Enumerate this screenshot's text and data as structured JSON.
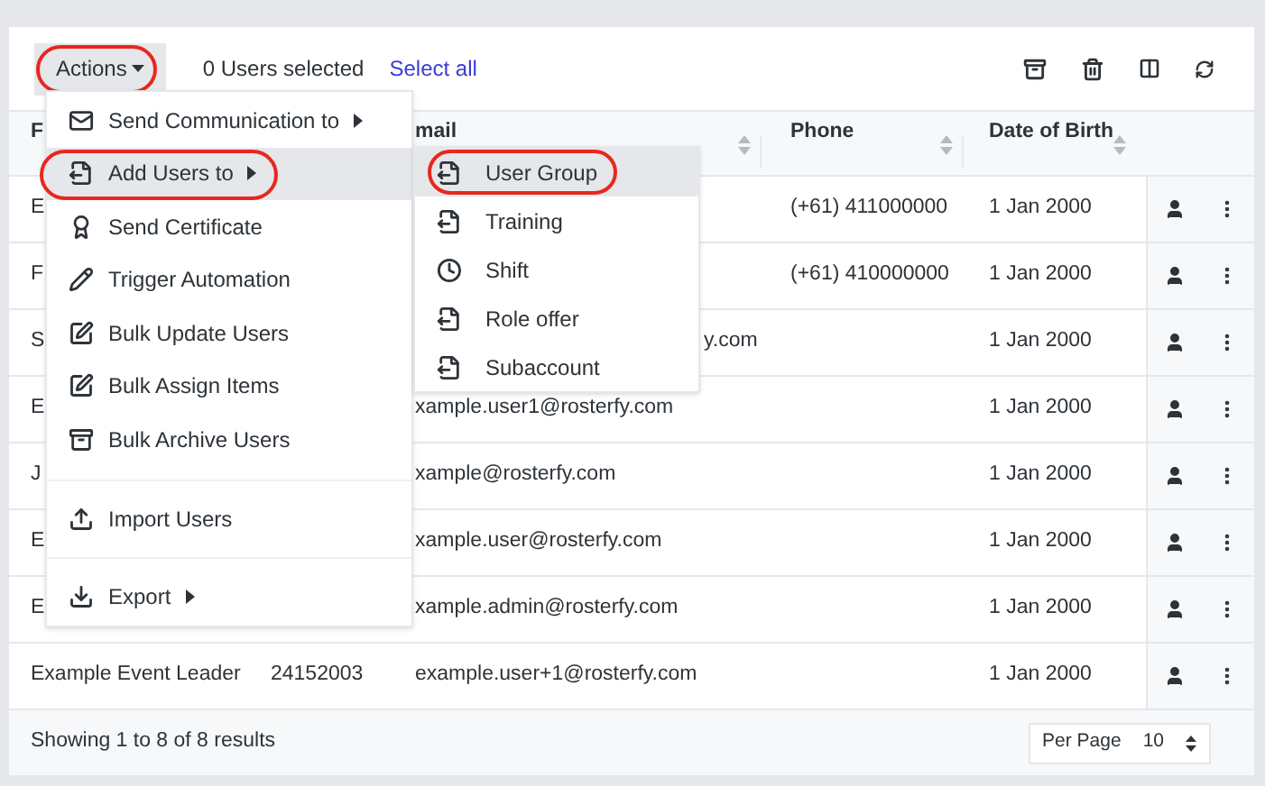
{
  "toolbar": {
    "actions_button": {
      "label": "Actions",
      "highlighted": true
    },
    "selection_count": "0 Users selected",
    "select_all": "Select all"
  },
  "table": {
    "columns": [
      {
        "label": "F"
      },
      {
        "label": "mail",
        "sortable": true
      },
      {
        "label": "Phone",
        "sortable": true
      },
      {
        "label": "Date of Birth",
        "sortable": true
      }
    ],
    "rows": [
      {
        "name": "E",
        "phone": "(+61) 411000000",
        "dob": "1 Jan 2000"
      },
      {
        "name": "F",
        "phone": "(+61) 410000000",
        "dob": "1 Jan 2000"
      },
      {
        "name": "S",
        "email_tail": "y.com",
        "dob": "1 Jan 2000"
      },
      {
        "name": "E",
        "email": "xample.user1@rosterfy.com",
        "dob": "1 Jan 2000"
      },
      {
        "name": "J",
        "email": "xample@rosterfy.com",
        "dob": "1 Jan 2000"
      },
      {
        "name": "E",
        "email": "xample.user@rosterfy.com",
        "dob": "1 Jan 2000"
      },
      {
        "name": "E",
        "email": "xample.admin@rosterfy.com",
        "dob": "1 Jan 2000"
      },
      {
        "name": "Example Event Leader",
        "id": "24152003",
        "email": "example.user+1@rosterfy.com",
        "dob": "1 Jan 2000"
      }
    ]
  },
  "footer": {
    "summary": "Showing 1 to 8 of 8 results",
    "per_page_label": "Per Page",
    "per_page_value": "10"
  },
  "actions_menu": [
    {
      "label": "Send Communication to",
      "submenu": true,
      "selected": false,
      "highlighted": false,
      "divider_before": false
    },
    {
      "label": "Add Users to",
      "submenu": true,
      "selected": true,
      "highlighted": true,
      "divider_before": false
    },
    {
      "label": "Send Certificate",
      "submenu": false,
      "selected": false,
      "highlighted": false,
      "divider_before": false
    },
    {
      "label": "Trigger Automation",
      "submenu": false,
      "selected": false,
      "highlighted": false,
      "divider_before": false
    },
    {
      "label": "Bulk Update Users",
      "submenu": false,
      "selected": false,
      "highlighted": false,
      "divider_before": false
    },
    {
      "label": "Bulk Assign Items",
      "submenu": false,
      "selected": false,
      "highlighted": false,
      "divider_before": false
    },
    {
      "label": "Bulk Archive Users",
      "submenu": false,
      "selected": false,
      "highlighted": false,
      "divider_before": false
    },
    {
      "label": "Import Users",
      "submenu": false,
      "selected": false,
      "highlighted": false,
      "divider_before": true
    },
    {
      "label": "Export",
      "submenu": true,
      "selected": false,
      "highlighted": false,
      "divider_before": true
    }
  ],
  "submenu": [
    {
      "label": "User Group",
      "selected": true,
      "highlighted": true
    },
    {
      "label": "Training",
      "selected": false,
      "highlighted": false
    },
    {
      "label": "Shift",
      "selected": false,
      "highlighted": false
    },
    {
      "label": "Role offer",
      "selected": false,
      "highlighted": false
    },
    {
      "label": "Subaccount",
      "selected": false,
      "highlighted": false
    }
  ]
}
